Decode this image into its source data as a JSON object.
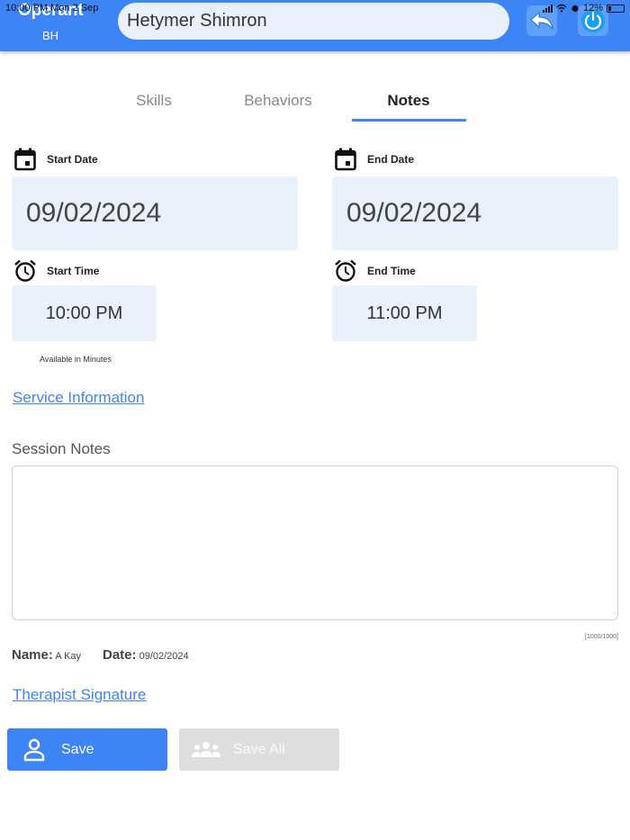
{
  "status_bar": {
    "time": "10:00 PM",
    "date": "Mon 2 Sep",
    "battery": "12%"
  },
  "header": {
    "brand": "Operant",
    "brand_sub": "BH",
    "client_name": "Hetymer Shimron"
  },
  "tabs": [
    {
      "label": "Skills",
      "active": false
    },
    {
      "label": "Behaviors",
      "active": false
    },
    {
      "label": "Notes",
      "active": true
    }
  ],
  "start_date": {
    "label": "Start Date",
    "value": "09/02/2024"
  },
  "end_date": {
    "label": "End Date",
    "value": "09/02/2024"
  },
  "start_time": {
    "label": "Start Time",
    "value": "10:00 PM"
  },
  "end_time": {
    "label": "End Time",
    "value": "11:00 PM"
  },
  "available_note": "Available in Minutes",
  "service_information_link": "Service Information",
  "session_notes": {
    "label": "Session Notes",
    "value": "",
    "counter": "[1000/1000]"
  },
  "meta": {
    "name_label": "Name:",
    "name_value": "A Kay",
    "date_label": "Date:",
    "date_value": "09/02/2024"
  },
  "therapist_signature_link": "Therapist Signature",
  "buttons": {
    "save": "Save",
    "save_all": "Save All"
  },
  "colors": {
    "accent": "#3d84f6",
    "field_bg": "#e9f1fc",
    "disabled": "#dedede"
  }
}
